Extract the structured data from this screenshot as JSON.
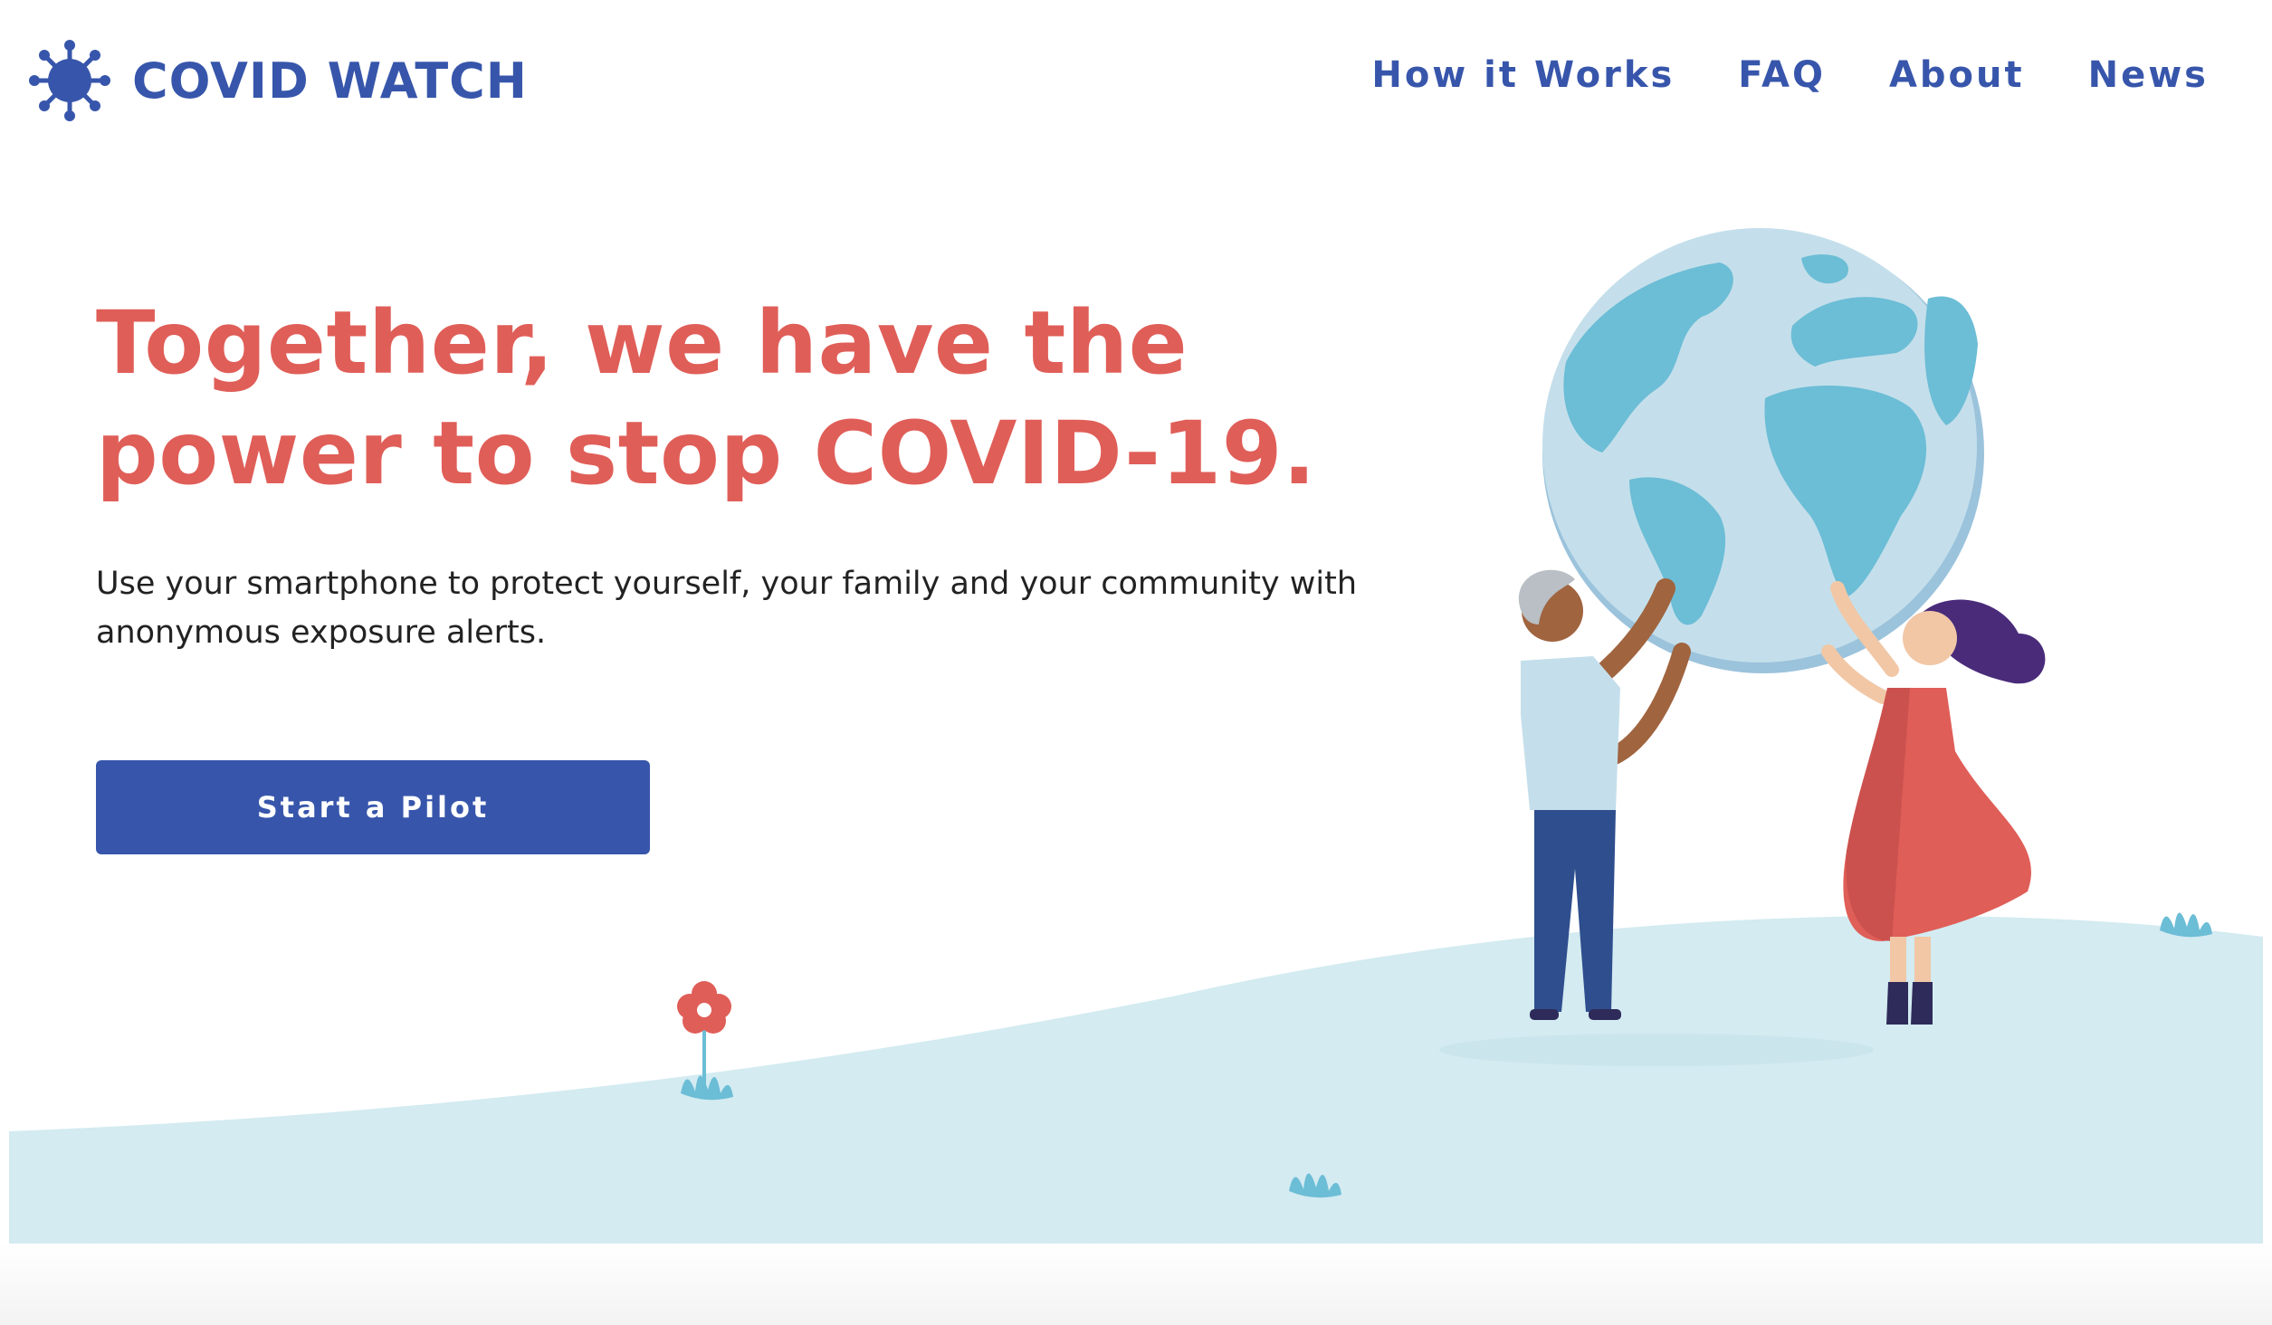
{
  "header": {
    "logo_text": "COVID WATCH",
    "nav": [
      "How it Works",
      "FAQ",
      "About",
      "News"
    ]
  },
  "hero": {
    "title_line1": "Together, we have the",
    "title_line2": "power to stop COVID-19.",
    "subtitle": "Use your smartphone to protect yourself, your family and your community with anonymous exposure alerts.",
    "cta_label": "Start a Pilot"
  },
  "colors": {
    "brand_blue": "#3756ab",
    "accent_red": "#e05e58",
    "text_dark": "#222222",
    "ground": "#d3ebf1",
    "globe_ocean": "#c4dfeb",
    "globe_land": "#6cbdd6"
  },
  "icons": [
    "virus-logo-icon"
  ]
}
